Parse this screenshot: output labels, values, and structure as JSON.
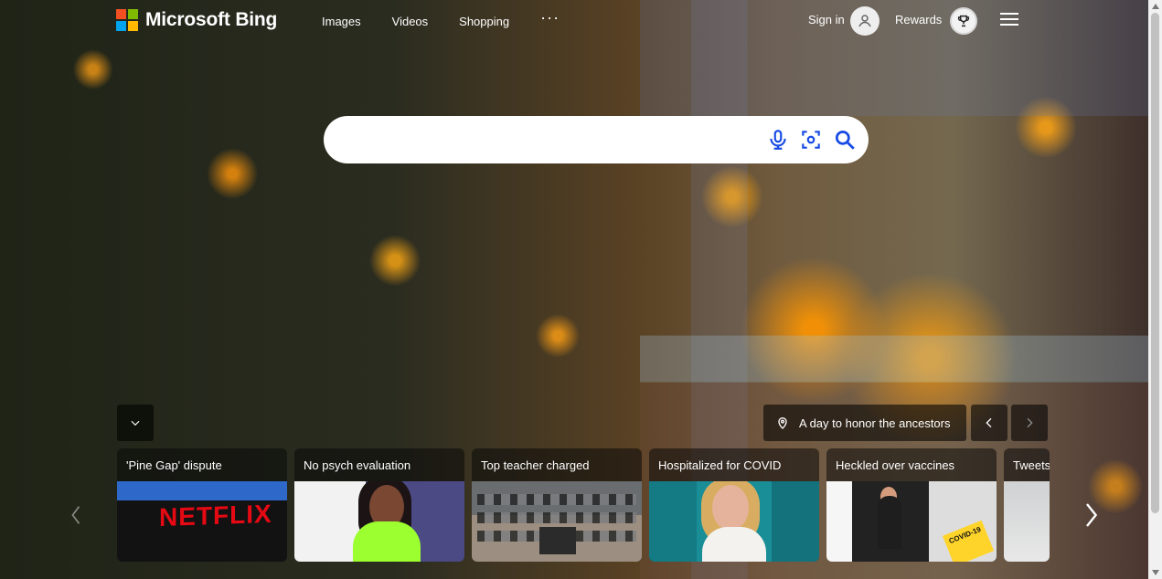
{
  "header": {
    "brand": "Microsoft Bing",
    "nav": [
      "Images",
      "Videos",
      "Shopping",
      "···"
    ],
    "sign_in": "Sign in",
    "rewards": "Rewards"
  },
  "search": {
    "placeholder": ""
  },
  "background": {
    "caption": "A day to honor the ancestors"
  },
  "news": {
    "cards": [
      {
        "title": "'Pine Gap' dispute",
        "image_text": "NETFLIX"
      },
      {
        "title": "No psych evaluation"
      },
      {
        "title": "Top teacher charged"
      },
      {
        "title": "Hospitalized for COVID"
      },
      {
        "title": "Heckled over vaccines",
        "image_text": "COVID-19"
      },
      {
        "title": "Tweets"
      }
    ]
  },
  "colors": {
    "ms_red": "#f25022",
    "ms_green": "#7fba00",
    "ms_blue": "#00a4ef",
    "ms_yellow": "#ffb900",
    "overlay": "#000000",
    "search_icon_blue": "#174ae4"
  },
  "icons": [
    "microsoft-logo",
    "user-icon",
    "trophy-icon",
    "hamburger-menu-icon",
    "microphone-icon",
    "visual-search-icon",
    "search-icon",
    "chevron-down-icon",
    "location-pin-icon",
    "chevron-left-icon",
    "chevron-right-icon"
  ]
}
